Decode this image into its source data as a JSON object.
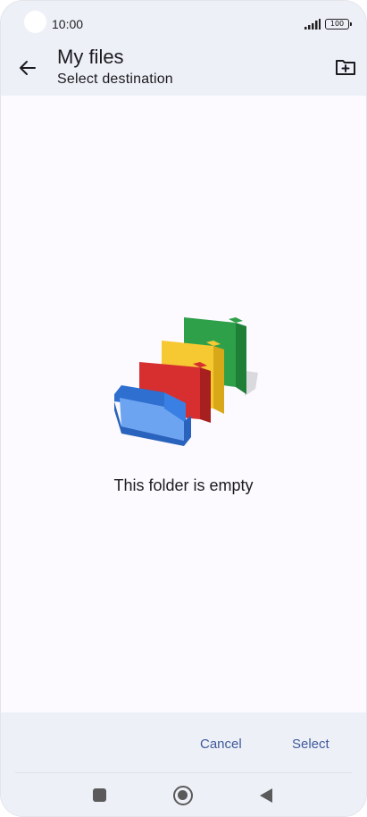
{
  "status_bar": {
    "time": "10:00",
    "battery": "100",
    "icons": [
      "signal-icon",
      "battery-icon"
    ]
  },
  "app_bar": {
    "title": "My files",
    "subtitle": "Select destination",
    "icons": [
      "back-arrow-icon",
      "new-folder-icon"
    ]
  },
  "empty_state": {
    "message": "This folder is empty",
    "illustration": "folders-illustration",
    "colors": {
      "blue": "#3a7fe3",
      "red": "#d72f2f",
      "yellow": "#f6c832",
      "green": "#2fa04a"
    }
  },
  "actions": {
    "cancel_label": "Cancel",
    "select_label": "Select",
    "accent": "#3f5a9a"
  },
  "nav_bar": {
    "icons": [
      "recents-square-icon",
      "home-circle-icon",
      "back-triangle-icon"
    ]
  }
}
